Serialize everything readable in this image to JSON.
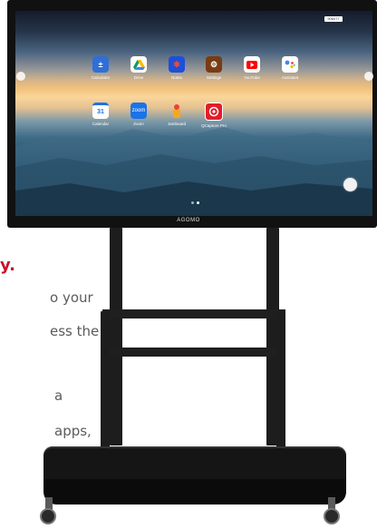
{
  "page_text": {
    "accent_char": "y.",
    "lines": [
      "o your",
      "ess the",
      "a",
      "apps,"
    ]
  },
  "monitor": {
    "brand": "AGOMO",
    "chip_label": "906077"
  },
  "apps": [
    {
      "label": "Calculator",
      "icon": "calculator-icon",
      "color": "#2f6fd6"
    },
    {
      "label": "Drive",
      "icon": "drive-icon",
      "color": "#ffffff"
    },
    {
      "label": "Notes",
      "icon": "notes-icon",
      "color": "#1e4fd8"
    },
    {
      "label": "Settings",
      "icon": "settings-icon",
      "color": "#7a3b12"
    },
    {
      "label": "YouTube",
      "icon": "youtube-icon",
      "color": "#ffffff"
    },
    {
      "label": "Assistant",
      "icon": "assistant-icon",
      "color": "#ffffff"
    },
    {
      "label": "Calendar",
      "icon": "calendar-icon",
      "color": "#ffffff"
    },
    {
      "label": "Zoom",
      "icon": "zoom-icon",
      "color": "#1a73e8"
    },
    {
      "label": "Jamboard",
      "icon": "jamboard-icon",
      "color": "#f4a81d"
    },
    {
      "label": "QCapture Pro",
      "icon": "camera-icon",
      "color": "#e11d2a"
    }
  ],
  "zoom_icon_text": "zoom",
  "calendar_icon_text": "31"
}
